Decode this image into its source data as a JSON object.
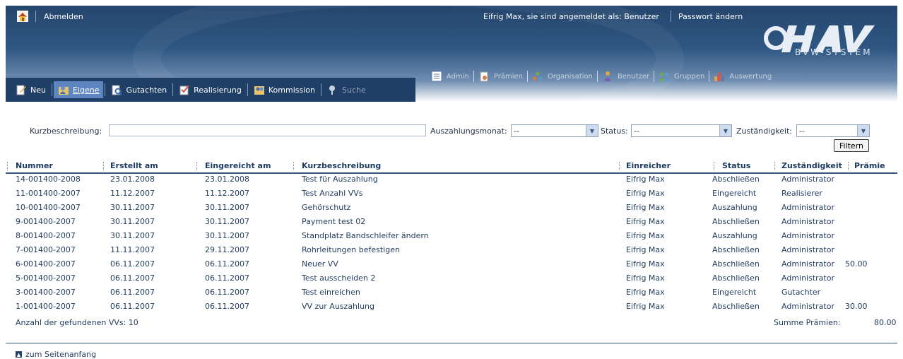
{
  "header": {
    "logout": "Abmelden",
    "user_info": "Eifrig Max, sie sind angemeldet als: Benutzer",
    "password_change": "Passwort ändern",
    "logo_sub": "BVW-SYSTEM"
  },
  "left_nav": {
    "new": "Neu",
    "own": "Eigene",
    "expertise": "Gutachten",
    "realization": "Realisierung",
    "commission": "Kommission",
    "search": "Suche"
  },
  "right_nav": {
    "admin": "Admin",
    "premiums": "Prämien",
    "organisation": "Organisation",
    "users": "Benutzer",
    "groups": "Gruppen",
    "evaluation": "Auswertung"
  },
  "filter": {
    "kurz_label": "Kurzbeschreibung:",
    "kurz_value": "",
    "month_label": "Auszahlungsmonat:",
    "month_value": "--",
    "status_label": "Status:",
    "status_value": "--",
    "resp_label": "Zuständigkeit:",
    "resp_value": "--",
    "button": "Filtern"
  },
  "table": {
    "headers": {
      "nummer": "Nummer",
      "erstellt": "Erstellt am",
      "eingereicht": "Eingereicht am",
      "kurz": "Kurzbeschreibung",
      "einreicher": "Einreicher",
      "status": "Status",
      "zust": "Zuständigkeit",
      "praemie": "Prämie"
    },
    "rows": [
      {
        "nummer": "14-001400-2008",
        "erstellt": "23.01.2008",
        "eingereicht": "23.01.2008",
        "kurz": "Test für Auszahlung",
        "einreicher": "Eifrig Max",
        "status": "Abschließen",
        "zust": "Administrator",
        "praemie": ""
      },
      {
        "nummer": "11-001400-2007",
        "erstellt": "11.12.2007",
        "eingereicht": "11.12.2007",
        "kurz": "Test Anzahl VVs",
        "einreicher": "Eifrig Max",
        "status": "Eingereicht",
        "zust": "Realisierer",
        "praemie": ""
      },
      {
        "nummer": "10-001400-2007",
        "erstellt": "30.11.2007",
        "eingereicht": "30.11.2007",
        "kurz": "Gehörschutz",
        "einreicher": "Eifrig Max",
        "status": "Auszahlung",
        "zust": "Administrator",
        "praemie": ""
      },
      {
        "nummer": "9-001400-2007",
        "erstellt": "30.11.2007",
        "eingereicht": "30.11.2007",
        "kurz": "Payment test 02",
        "einreicher": "Eifrig Max",
        "status": "Abschließen",
        "zust": "Administrator",
        "praemie": ""
      },
      {
        "nummer": "8-001400-2007",
        "erstellt": "30.11.2007",
        "eingereicht": "30.11.2007",
        "kurz": "Standplatz Bandschleifer ändern",
        "einreicher": "Eifrig Max",
        "status": "Auszahlung",
        "zust": "Administrator",
        "praemie": ""
      },
      {
        "nummer": "7-001400-2007",
        "erstellt": "11.11.2007",
        "eingereicht": "29.11.2007",
        "kurz": "Rohrleitungen befestigen",
        "einreicher": "Eifrig Max",
        "status": "Abschließen",
        "zust": "Administrator",
        "praemie": ""
      },
      {
        "nummer": "6-001400-2007",
        "erstellt": "06.11.2007",
        "eingereicht": "06.11.2007",
        "kurz": "Neuer VV",
        "einreicher": "Eifrig Max",
        "status": "Abschließen",
        "zust": "Administrator",
        "praemie": "50.00"
      },
      {
        "nummer": "5-001400-2007",
        "erstellt": "06.11.2007",
        "eingereicht": "06.11.2007",
        "kurz": "Test ausscheiden 2",
        "einreicher": "Eifrig Max",
        "status": "Abschließen",
        "zust": "Administrator",
        "praemie": ""
      },
      {
        "nummer": "3-001400-2007",
        "erstellt": "06.11.2007",
        "eingereicht": "06.11.2007",
        "kurz": "Test einreichen",
        "einreicher": "Eifrig Max",
        "status": "Eingereicht",
        "zust": "Gutachter",
        "praemie": ""
      },
      {
        "nummer": "1-001400-2007",
        "erstellt": "06.11.2007",
        "eingereicht": "06.11.2007",
        "kurz": "VV zur Auszahlung",
        "einreicher": "Eifrig Max",
        "status": "Abschließen",
        "zust": "Administrator",
        "praemie": "30.00"
      }
    ],
    "count_text": "Anzahl der gefundenen VVs: 10",
    "sum_label": "Summe Prämien:",
    "sum_value": "80.00"
  },
  "footer": {
    "to_top": "zum Seitenanfang"
  },
  "colors": {
    "header_dark": "#25466d",
    "nav_active": "#5d86c0",
    "text": "#1f3b5c"
  }
}
